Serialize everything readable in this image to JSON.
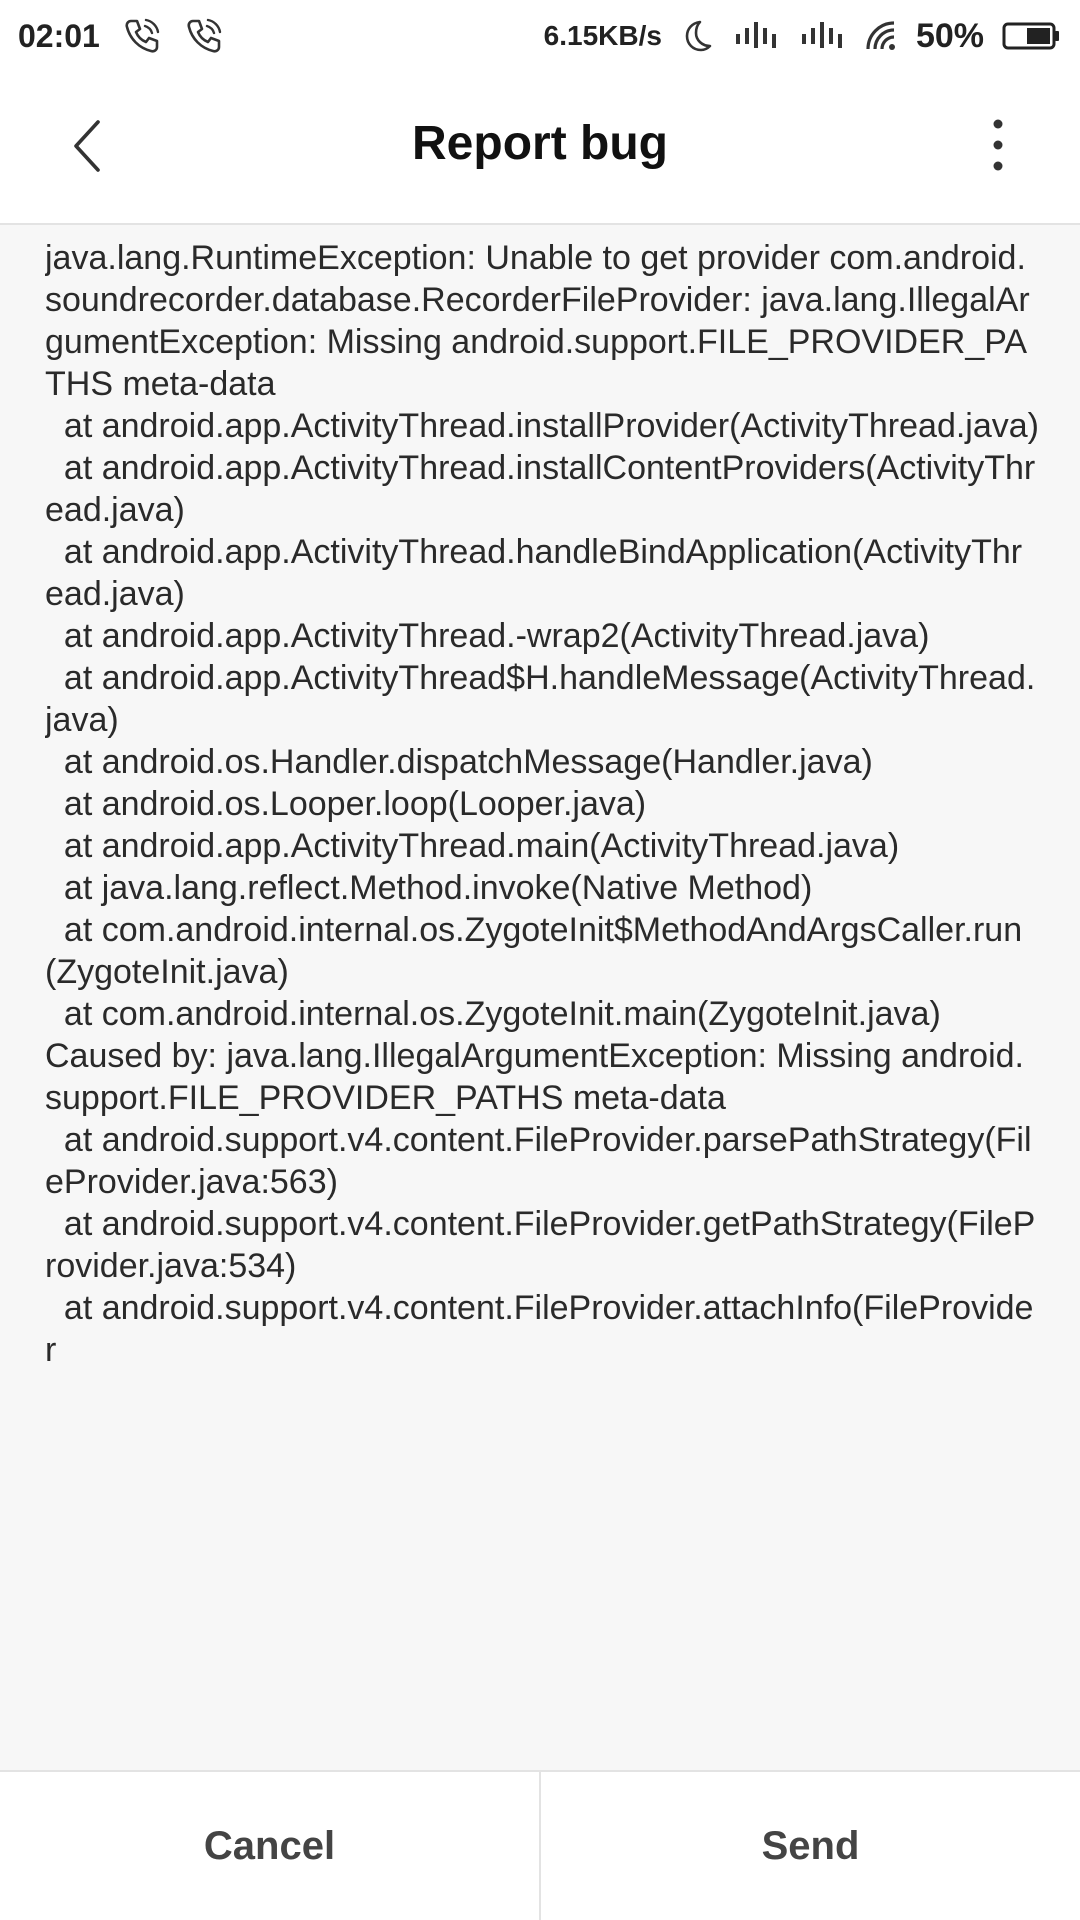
{
  "status_bar": {
    "time": "02:01",
    "network_speed": "6.15KB/s",
    "battery_percent": "50%",
    "icons": [
      "call-icon",
      "call-icon",
      "moon-icon",
      "signal-icon",
      "signal-icon",
      "wifi-icon",
      "battery-icon"
    ]
  },
  "header": {
    "title": "Report bug",
    "back_icon": "chevron-left-icon",
    "more_icon": "more-vertical-icon"
  },
  "log": {
    "text": "java.lang.RuntimeException: Unable to get provider com.android.soundrecorder.database.RecorderFileProvider: java.lang.IllegalArgumentException: Missing android.support.FILE_PROVIDER_PATHS meta-data\n  at android.app.ActivityThread.installProvider(ActivityThread.java)\n  at android.app.ActivityThread.installContentProviders(ActivityThread.java)\n  at android.app.ActivityThread.handleBindApplication(ActivityThread.java)\n  at android.app.ActivityThread.-wrap2(ActivityThread.java)\n  at android.app.ActivityThread$H.handleMessage(ActivityThread.java)\n  at android.os.Handler.dispatchMessage(Handler.java)\n  at android.os.Looper.loop(Looper.java)\n  at android.app.ActivityThread.main(ActivityThread.java)\n  at java.lang.reflect.Method.invoke(Native Method)\n  at com.android.internal.os.ZygoteInit$MethodAndArgsCaller.run(ZygoteInit.java)\n  at com.android.internal.os.ZygoteInit.main(ZygoteInit.java)\nCaused by: java.lang.IllegalArgumentException: Missing android.support.FILE_PROVIDER_PATHS meta-data\n  at android.support.v4.content.FileProvider.parsePathStrategy(FileProvider.java:563)\n  at android.support.v4.content.FileProvider.getPathStrategy(FileProvider.java:534)\n  at android.support.v4.content.FileProvider.attachInfo(FileProvider"
  },
  "actions": {
    "cancel_label": "Cancel",
    "send_label": "Send"
  }
}
